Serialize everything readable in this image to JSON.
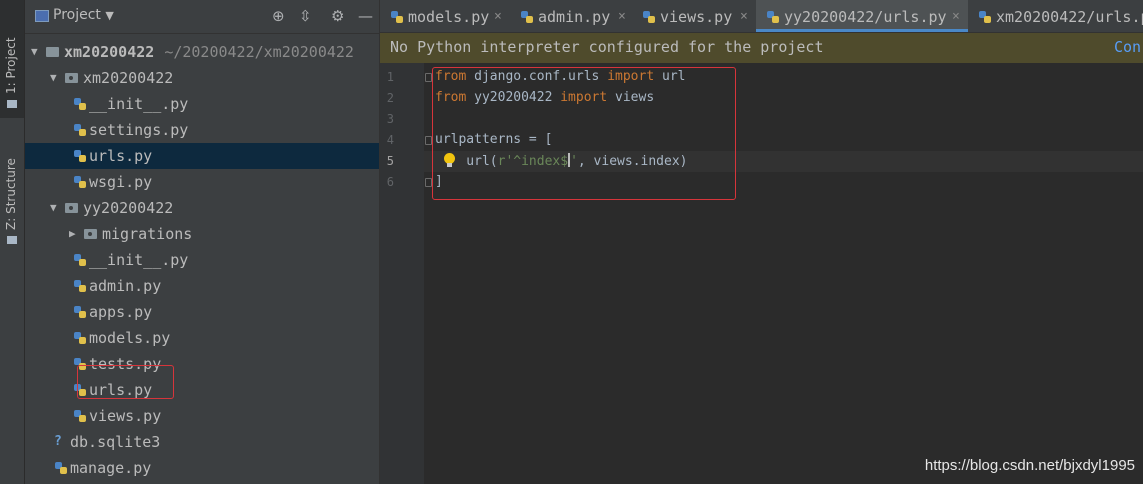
{
  "tool_strip": {
    "project_tab": "1: Project",
    "structure_tab": "Z: Structure"
  },
  "project_panel": {
    "title": "Project",
    "icons": [
      "locate-icon",
      "collapse-icon",
      "gear-icon",
      "minimize-icon"
    ],
    "tree": [
      {
        "label": "xm20200422",
        "path": "~/20200422/xm20200422",
        "kind": "root-folder",
        "expanded": true
      },
      {
        "label": "xm20200422",
        "kind": "package",
        "expanded": true
      },
      {
        "label": "__init__.py",
        "kind": "python-file"
      },
      {
        "label": "settings.py",
        "kind": "python-file"
      },
      {
        "label": "urls.py",
        "kind": "python-file",
        "selected": true
      },
      {
        "label": "wsgi.py",
        "kind": "python-file"
      },
      {
        "label": "yy20200422",
        "kind": "package",
        "expanded": true
      },
      {
        "label": "migrations",
        "kind": "package",
        "expanded": false
      },
      {
        "label": "__init__.py",
        "kind": "python-file"
      },
      {
        "label": "admin.py",
        "kind": "python-file"
      },
      {
        "label": "apps.py",
        "kind": "python-file"
      },
      {
        "label": "models.py",
        "kind": "python-file"
      },
      {
        "label": "tests.py",
        "kind": "python-file"
      },
      {
        "label": "urls.py",
        "kind": "python-file",
        "highlighted": true
      },
      {
        "label": "views.py",
        "kind": "python-file"
      },
      {
        "label": "db.sqlite3",
        "kind": "database-file"
      },
      {
        "label": "manage.py",
        "kind": "python-file"
      }
    ]
  },
  "tabs": [
    {
      "label": "models.py",
      "close": "×"
    },
    {
      "label": "admin.py",
      "close": "×"
    },
    {
      "label": "views.py",
      "close": "×"
    },
    {
      "label": "yy20200422/urls.py",
      "close": "×",
      "active": true
    },
    {
      "label": "xm20200422/urls.p"
    }
  ],
  "banner": {
    "message": "No Python interpreter configured for the project",
    "action": "Con"
  },
  "editor": {
    "line_numbers": [
      "1",
      "2",
      "3",
      "4",
      "5",
      "6"
    ],
    "current_line": 5,
    "lines": [
      [
        {
          "t": "from",
          "c": "kw"
        },
        {
          "t": " django.conf.urls ",
          "c": ""
        },
        {
          "t": "import",
          "c": "kw"
        },
        {
          "t": " url",
          "c": ""
        }
      ],
      [
        {
          "t": "from",
          "c": "kw"
        },
        {
          "t": " yy20200422 ",
          "c": ""
        },
        {
          "t": "import",
          "c": "kw"
        },
        {
          "t": " views",
          "c": ""
        }
      ],
      [],
      [
        {
          "t": "urlpatterns = [",
          "c": ""
        }
      ],
      [
        {
          "t": "    url(",
          "c": ""
        },
        {
          "t": "r'^index$",
          "c": "str"
        },
        {
          "t": "|",
          "c": "caret"
        },
        {
          "t": "'",
          "c": "str"
        },
        {
          "t": ", views.index)",
          "c": ""
        }
      ],
      [
        {
          "t": "]",
          "c": ""
        }
      ]
    ]
  },
  "colors": {
    "keyword": "#cc7832",
    "string": "#6a8759",
    "default_text": "#a9b7c6",
    "highlight_box": "#d6353b",
    "banner_bg": "#4f4b2c",
    "selection_bg": "#0d293e"
  },
  "watermark": "https://blog.csdn.net/bjxdyl1995"
}
